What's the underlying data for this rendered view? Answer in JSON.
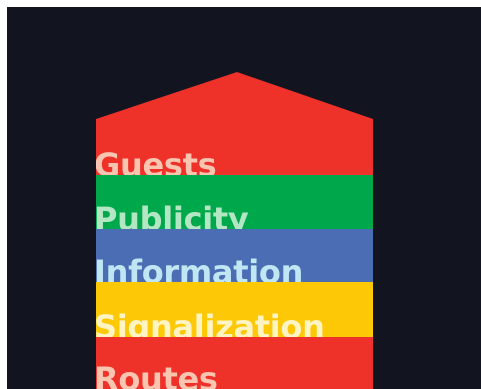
{
  "diagram": {
    "background_color": "#12151f",
    "layers": [
      {
        "label": "Guests",
        "fill_color": "#ee3129",
        "text_color": "#f9c4b0"
      },
      {
        "label": "Publicity",
        "fill_color": "#00a84c",
        "text_color": "#b3e6c2"
      },
      {
        "label": "Information",
        "fill_color": "#4a6db3",
        "text_color": "#bfe6f2"
      },
      {
        "label": "Signalization",
        "fill_color": "#fdc805",
        "text_color": "#fff4c2"
      },
      {
        "label": "Routes",
        "fill_color": "#ee3129",
        "text_color": "#f9c4b0"
      }
    ]
  }
}
